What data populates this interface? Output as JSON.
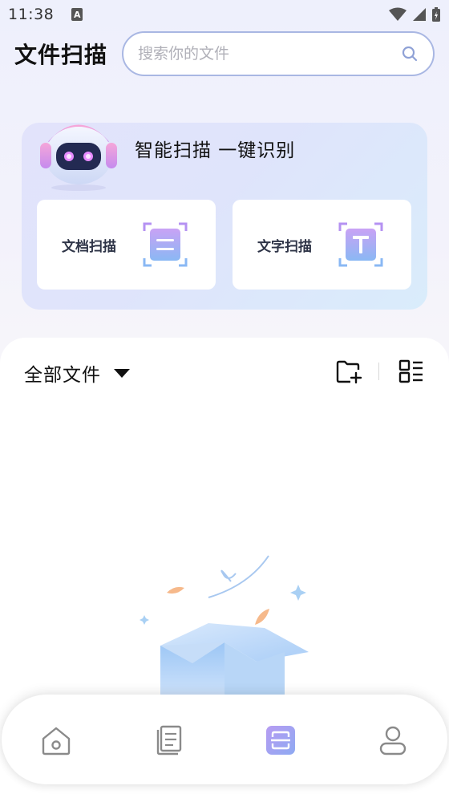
{
  "status_bar": {
    "time": "11:38",
    "notification_letter": "A",
    "icons": [
      "wifi-icon",
      "signal-icon",
      "battery-charging-icon"
    ]
  },
  "header": {
    "title": "文件扫描",
    "search_placeholder": "搜索你的文件",
    "search_value": ""
  },
  "scan_card": {
    "slogan": "智能扫描 一键识别",
    "buttons": [
      {
        "label": "文档扫描",
        "icon": "document-scan-icon"
      },
      {
        "label": "文字扫描",
        "icon": "text-scan-icon"
      }
    ]
  },
  "files": {
    "filter_label": "全部文件",
    "actions": [
      "add-folder-icon",
      "list-view-icon"
    ]
  },
  "empty_state": {
    "illustration": "empty-box-illustration"
  },
  "bottom_nav": {
    "items": [
      {
        "icon": "home-icon",
        "active": false
      },
      {
        "icon": "documents-icon",
        "active": false
      },
      {
        "icon": "scan-icon",
        "active": true
      },
      {
        "icon": "profile-icon",
        "active": false
      }
    ],
    "active_color": "#9a8cf0"
  },
  "colors": {
    "accent_purple": "#9a8cf0",
    "accent_blue": "#7fb5f2",
    "search_border": "#a9b7e3",
    "text_dark": "#111111"
  }
}
